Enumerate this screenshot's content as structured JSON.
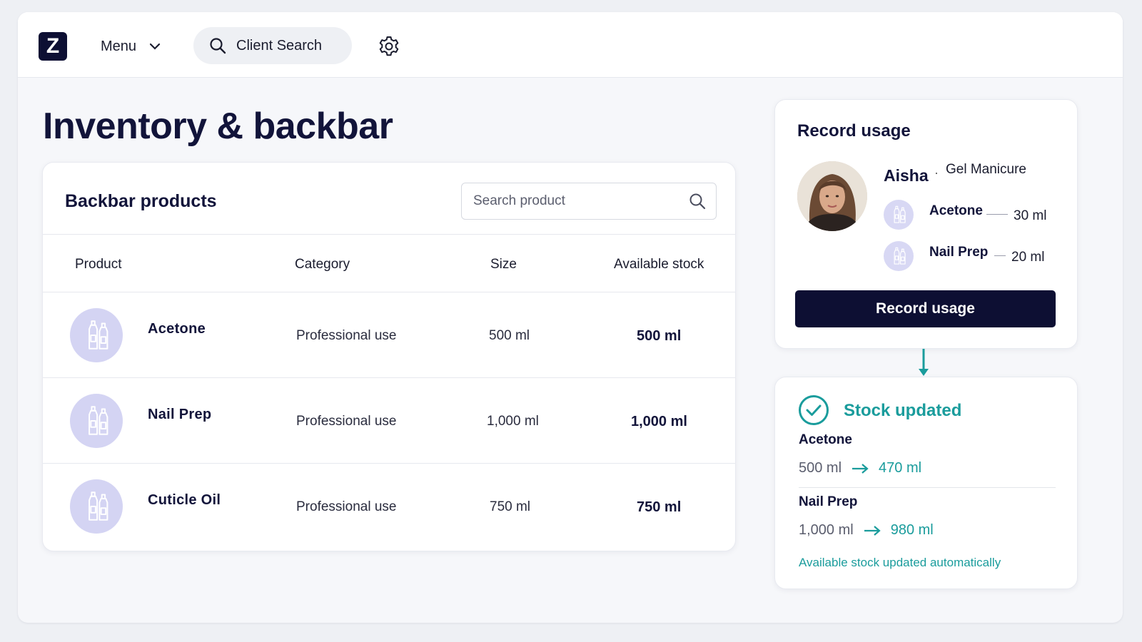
{
  "header": {
    "logo_letter": "Z",
    "menu_label": "Menu",
    "client_search_label": "Client Search"
  },
  "page": {
    "title": "Inventory & backbar"
  },
  "products": {
    "title": "Backbar products",
    "search_placeholder": "Search product",
    "columns": [
      "Product",
      "Category",
      "Size",
      "Available stock"
    ],
    "rows": [
      {
        "name": "Acetone",
        "category": "Professional use",
        "size": "500 ml",
        "stock": "500 ml"
      },
      {
        "name": "Nail Prep",
        "category": "Professional use",
        "size": "1,000 ml",
        "stock": "1,000 ml"
      },
      {
        "name": "Cuticle Oil",
        "category": "Professional use",
        "size": "750 ml",
        "stock": "750 ml"
      }
    ]
  },
  "usage": {
    "title": "Record usage",
    "client_name": "Aisha",
    "separator": "·",
    "service": "Gel Manicure",
    "items": [
      {
        "name": "Acetone",
        "amount": "30 ml"
      },
      {
        "name": "Nail Prep",
        "amount": "20 ml"
      }
    ],
    "button_label": "Record usage"
  },
  "stock_update": {
    "title": "Stock updated",
    "items": [
      {
        "name": "Acetone",
        "from": "500 ml",
        "to": "470 ml"
      },
      {
        "name": "Nail Prep",
        "from": "1,000 ml",
        "to": "980 ml"
      }
    ],
    "footnote": "Available stock updated automatically"
  },
  "colors": {
    "navy": "#0d0f33",
    "teal": "#1a9c9c",
    "lavender": "#d4d4f3"
  }
}
